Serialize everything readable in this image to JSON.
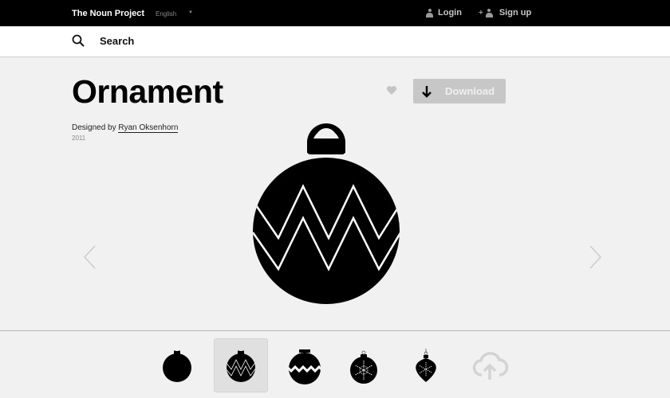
{
  "topbar": {
    "brand": "The Noun Project",
    "language": "English",
    "login_label": "Login",
    "signup_label": "Sign up"
  },
  "search": {
    "label": "Search"
  },
  "icon_detail": {
    "title": "Ornament",
    "designed_by_prefix": "Designed by",
    "designer": "Ryan Oksenhorn",
    "year": "2011",
    "download_label": "Download"
  },
  "colors": {
    "topbar_bg": "#000000",
    "page_bg": "#f1f1f1",
    "download_bg": "#c7c7c7",
    "icon_fill": "#000000"
  },
  "thumbnails": [
    {
      "name": "plain-ornament",
      "selected": false
    },
    {
      "name": "zigzag-ornament",
      "selected": true
    },
    {
      "name": "wave-band-ornament",
      "selected": false
    },
    {
      "name": "snowflake-round-ornament",
      "selected": false
    },
    {
      "name": "snowflake-drop-ornament",
      "selected": false
    },
    {
      "name": "upload-cloud",
      "selected": false
    }
  ]
}
